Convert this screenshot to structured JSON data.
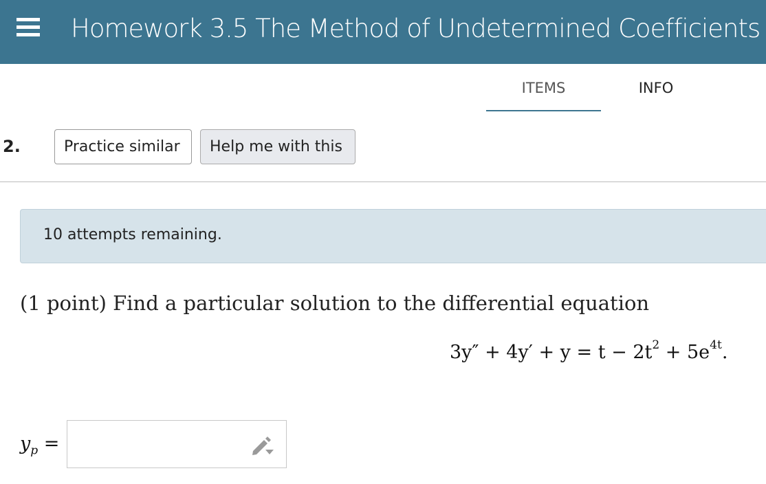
{
  "header": {
    "title": "Homework 3.5 The Method of Undetermined Coefficients",
    "menu_icon": "hamburger-menu-icon",
    "background_color": "#3c7590"
  },
  "tabs": [
    {
      "label": "ITEMS",
      "active": true
    },
    {
      "label": "INFO",
      "active": false
    }
  ],
  "question": {
    "number": "2.",
    "practice_label": "Practice similar",
    "help_label": "Help me with this",
    "attempts_text": "10 attempts remaining.",
    "prompt": "(1 point) Find a particular solution to the differential equation",
    "equation": {
      "lhs": "3y″ + 4y′ + y",
      "rhs_main": "t − 2t",
      "exp1": "2",
      "rhs_tail": " + 5e",
      "exp2": "4t",
      "end": "."
    },
    "answer_label": "y",
    "answer_sub": "p",
    "answer_eq": " =",
    "answer_value": "",
    "answer_icon": "pencil-dropdown-icon"
  },
  "colors": {
    "accent": "#3c7590",
    "attempts_bg": "#d6e3ea"
  }
}
